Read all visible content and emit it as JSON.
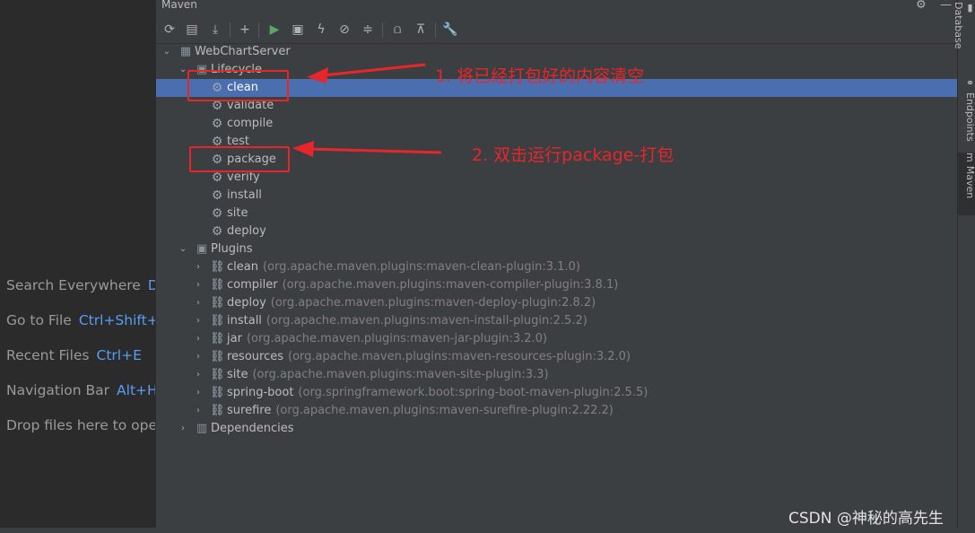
{
  "left_hints": [
    {
      "label": "Search Everywhere",
      "shortcut": "D"
    },
    {
      "label": "Go to File",
      "shortcut": "Ctrl+Shift+"
    },
    {
      "label": "Recent Files",
      "shortcut": "Ctrl+E"
    },
    {
      "label": "Navigation Bar",
      "shortcut": "Alt+H"
    },
    {
      "label": "Drop files here to ope",
      "shortcut": ""
    }
  ],
  "panel": {
    "title": "Maven",
    "header_icons": [
      "gear-icon",
      "minimize-icon"
    ]
  },
  "toolbar": [
    "reload-icon",
    "add-folder-icon",
    "download-icon",
    "add-icon",
    "run-icon",
    "execute-goal-icon",
    "toggle-offline-icon",
    "skip-tests-icon",
    "collapse-all-icon",
    "show-dependencies-icon",
    "expand-icon",
    "settings-wrench-icon"
  ],
  "tree": {
    "project": "WebChartServer",
    "lifecycle_label": "Lifecycle",
    "lifecycle": [
      "clean",
      "validate",
      "compile",
      "test",
      "package",
      "verify",
      "install",
      "site",
      "deploy"
    ],
    "selected": "clean",
    "plugins_label": "Plugins",
    "plugins": [
      {
        "name": "clean",
        "coord": "(org.apache.maven.plugins:maven-clean-plugin:3.1.0)"
      },
      {
        "name": "compiler",
        "coord": "(org.apache.maven.plugins:maven-compiler-plugin:3.8.1)"
      },
      {
        "name": "deploy",
        "coord": "(org.apache.maven.plugins:maven-deploy-plugin:2.8.2)"
      },
      {
        "name": "install",
        "coord": "(org.apache.maven.plugins:maven-install-plugin:2.5.2)"
      },
      {
        "name": "jar",
        "coord": "(org.apache.maven.plugins:maven-jar-plugin:3.2.0)"
      },
      {
        "name": "resources",
        "coord": "(org.apache.maven.plugins:maven-resources-plugin:3.2.0)"
      },
      {
        "name": "site",
        "coord": "(org.apache.maven.plugins:maven-site-plugin:3.3)"
      },
      {
        "name": "spring-boot",
        "coord": "(org.springframework.boot:spring-boot-maven-plugin:2.5.5)"
      },
      {
        "name": "surefire",
        "coord": "(org.apache.maven.plugins:maven-surefire-plugin:2.22.2)"
      }
    ],
    "dependencies_label": "Dependencies"
  },
  "right_bar": [
    "Database",
    "Endpoints",
    "Maven"
  ],
  "annotations": {
    "note1": "1. 将已经打包好的内容清空",
    "note2": "2. 双击运行package-打包",
    "color": "#e8262a"
  },
  "watermark": "CSDN @神秘的高先生",
  "colors": {
    "selection": "#4b6eaf",
    "panel_bg": "#3c3f41",
    "editor_bg": "#2b2b2b",
    "shortcut": "#589df6"
  }
}
